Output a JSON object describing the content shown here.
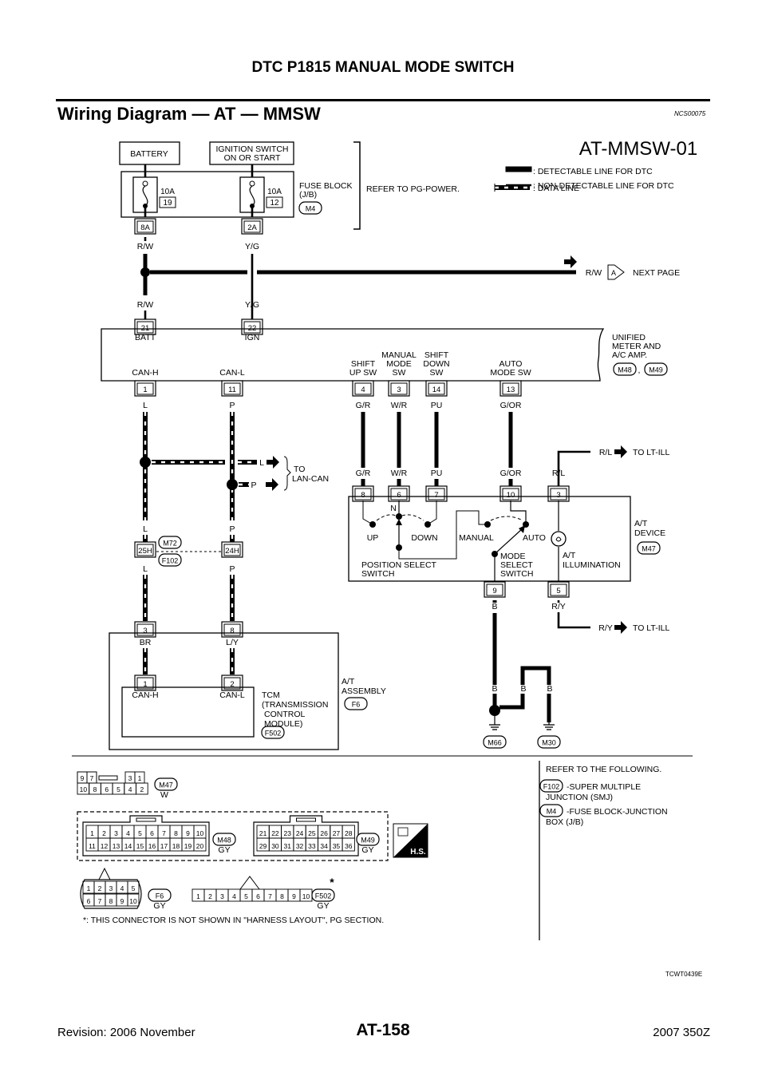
{
  "header": {
    "title": "DTC P1815 MANUAL MODE SWITCH"
  },
  "section": {
    "title": "Wiring Diagram — AT — MMSW",
    "code": "NCS00075"
  },
  "diagram": {
    "id": "AT-MMSW-01",
    "legend": {
      "detectable": ": DETECTABLE LINE FOR DTC",
      "non_detectable": ": NON-DETECTABLE LINE FOR DTC",
      "data": ": DATA LINE"
    },
    "battery": "BATTERY",
    "ignition": {
      "l1": "IGNITION SWITCH",
      "l2": "ON OR START"
    },
    "fuse_block": {
      "l1": "FUSE BLOCK",
      "l2": "(J/B)",
      "conn": "M4",
      "f1_rating": "10A",
      "f1_no": "19",
      "f1_pin": "8A",
      "f2_rating": "10A",
      "f2_no": "12",
      "f2_pin": "2A"
    },
    "refer_power": "REFER TO PG-POWER.",
    "wire_colors": {
      "rw": "R/W",
      "yg": "Y/G",
      "l": "L",
      "p": "P",
      "gr": "G/R",
      "wr": "W/R",
      "pu": "PU",
      "gor": "G/OR",
      "rl": "R/L",
      "b": "B",
      "ry": "R/Y",
      "br": "BR",
      "ly": "L/Y"
    },
    "next_page": {
      "wire": "R/W",
      "connector": "A",
      "label": "NEXT PAGE"
    },
    "meter": {
      "l1": "UNIFIED",
      "l2": "METER AND",
      "l3": "A/C AMP.",
      "conn1": "M48",
      "sep": ",",
      "conn2": "M49",
      "pin_batt": "21",
      "pin_ign": "22",
      "batt": "BATT",
      "ign": "IGN",
      "can_h": "CAN-H",
      "can_l": "CAN-L",
      "pin_can_h": "1",
      "pin_can_l": "11",
      "shift_up": [
        "SHIFT",
        "UP SW"
      ],
      "manual": [
        "MANUAL",
        "MODE",
        "SW"
      ],
      "shift_down": [
        "SHIFT",
        "DOWN",
        "SW"
      ],
      "auto": [
        "AUTO",
        "MODE SW"
      ],
      "pin_up": "4",
      "pin_manual": "3",
      "pin_down": "14",
      "pin_auto": "13"
    },
    "lan": {
      "l": "L",
      "p": "P",
      "to1": "TO",
      "to2": "LAN-CAN"
    },
    "junction": {
      "pin_l": "25H",
      "pin_p": "24H",
      "conn1": "M72",
      "conn2": "F102"
    },
    "at_assembly": {
      "l1": "A/T",
      "l2": "ASSEMBLY",
      "conn": "F6",
      "pin_l": "3",
      "pin_p": "8",
      "tcm_pin_h": "1",
      "tcm_pin_l": "2",
      "can_h": "CAN-H",
      "can_l": "CAN-L",
      "tcm": [
        "TCM",
        "(TRANSMISSION",
        "CONTROL",
        "MODULE)"
      ],
      "tcm_conn": "F502"
    },
    "at_device": {
      "l1": "A/T",
      "l2": "DEVICE",
      "conn": "M47",
      "pins_top": [
        "8",
        "6",
        "7",
        "10",
        "3"
      ],
      "pins_bottom": [
        "9",
        "5"
      ],
      "n": "N",
      "up": "UP",
      "down": "DOWN",
      "manual": "MANUAL",
      "auto": "AUTO",
      "pos_sel": [
        "POSITION SELECT",
        "SWITCH"
      ],
      "mode_sel": [
        "MODE",
        "SELECT",
        "SWITCH"
      ],
      "illum": [
        "A/T",
        "ILLUMINATION"
      ]
    },
    "lt_ill": {
      "rl": "R/L",
      "ry": "R/Y",
      "label": "TO LT-ILL"
    },
    "grounds": [
      "M66",
      "M30"
    ]
  },
  "connectors": {
    "m47": {
      "id": "M47",
      "color": "W",
      "top": [
        "9",
        "7",
        "3",
        "1"
      ],
      "bottom": [
        "10",
        "8",
        "6",
        "5",
        "4",
        "2"
      ]
    },
    "m48": {
      "id": "M48",
      "color": "GY",
      "top": [
        "1",
        "2",
        "3",
        "4",
        "5",
        "6",
        "7",
        "8",
        "9",
        "10"
      ],
      "bottom": [
        "11",
        "12",
        "13",
        "14",
        "15",
        "16",
        "17",
        "18",
        "19",
        "20"
      ]
    },
    "m49": {
      "id": "M49",
      "color": "GY",
      "top": [
        "21",
        "22",
        "23",
        "24",
        "25",
        "26",
        "27",
        "28"
      ],
      "bottom": [
        "29",
        "30",
        "31",
        "32",
        "33",
        "34",
        "35",
        "36"
      ]
    },
    "f6": {
      "id": "F6",
      "color": "GY",
      "top": [
        "1",
        "2",
        "3",
        "4",
        "5"
      ],
      "bottom": [
        "6",
        "7",
        "8",
        "9",
        "10"
      ]
    },
    "f502": {
      "id": "F502",
      "color": "GY",
      "pins": [
        "1",
        "2",
        "3",
        "4",
        "5",
        "6",
        "7",
        "8",
        "9",
        "10"
      ],
      "star": "*"
    },
    "hs_icon": "H.S.",
    "footnote": "*: THIS CONNECTOR IS NOT SHOWN IN \"HARNESS LAYOUT\", PG SECTION."
  },
  "refer": {
    "title": "REFER TO THE FOLLOWING.",
    "items": [
      {
        "conn": "F102",
        "l1": "-SUPER MULTIPLE",
        "l2": "JUNCTION (SMJ)"
      },
      {
        "conn": "M4",
        "l1": "-FUSE BLOCK-JUNCTION",
        "l2": "BOX (J/B)"
      }
    ]
  },
  "figure_code": "TCWT0439E",
  "footer": {
    "revision": "Revision: 2006 November",
    "page": "AT-158",
    "model": "2007 350Z"
  }
}
